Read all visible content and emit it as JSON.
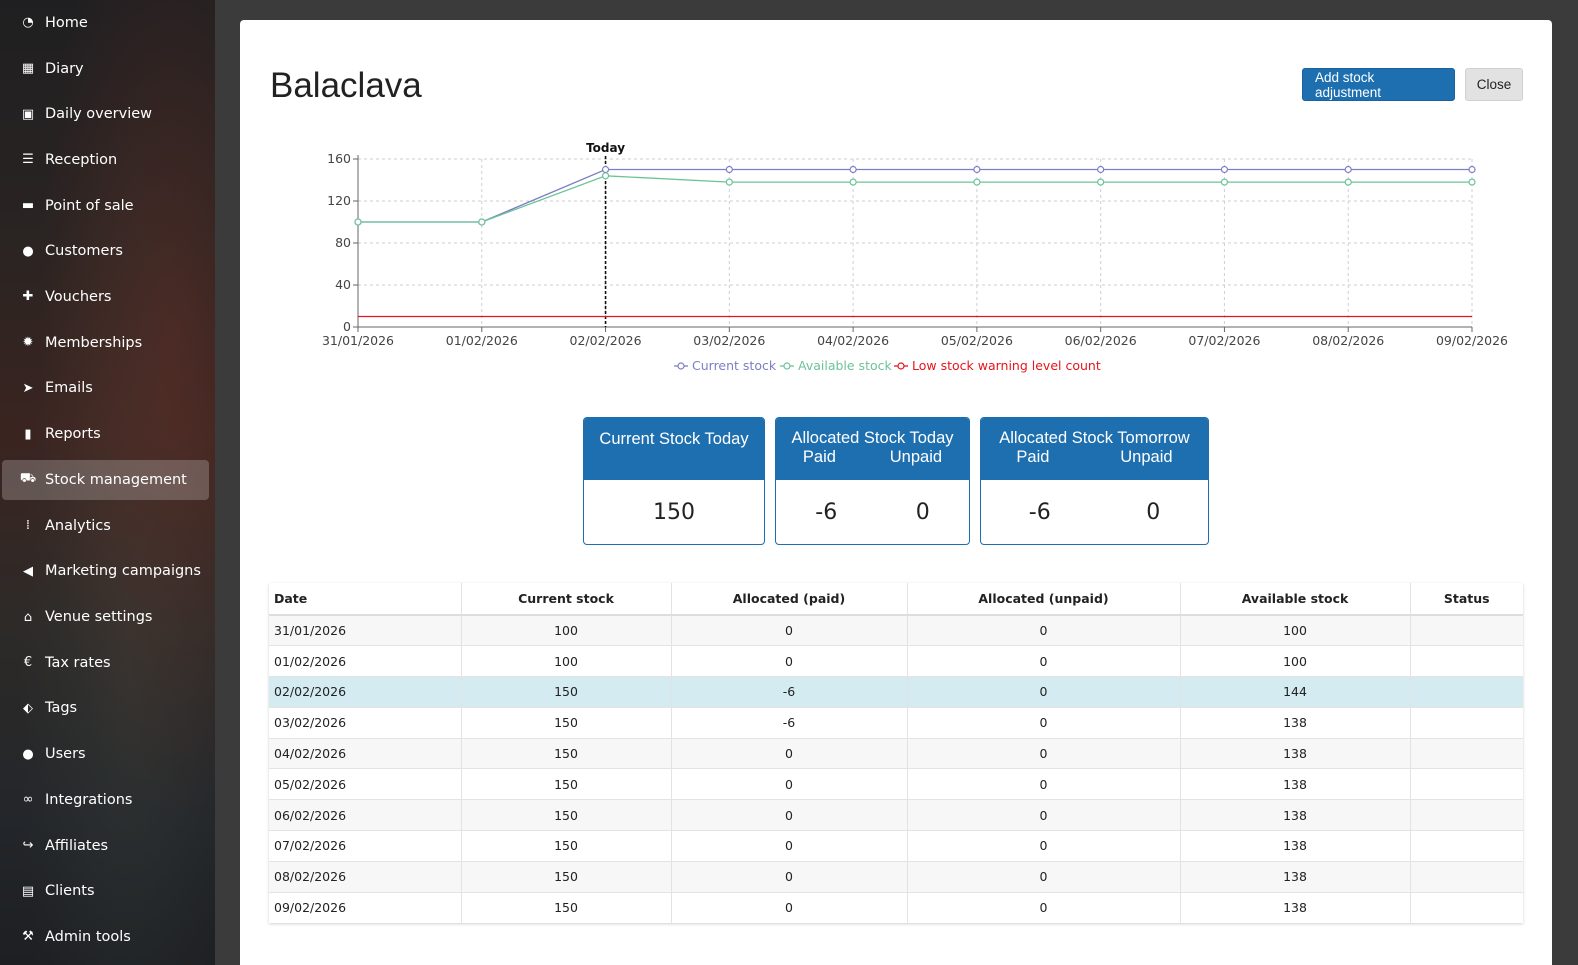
{
  "sidebar": {
    "items": [
      {
        "label": "Home",
        "icon": "dashboard-icon"
      },
      {
        "label": "Diary",
        "icon": "calendar-icon"
      },
      {
        "label": "Daily overview",
        "icon": "overview-icon"
      },
      {
        "label": "Reception",
        "icon": "reception-icon"
      },
      {
        "label": "Point of sale",
        "icon": "credit-card-icon"
      },
      {
        "label": "Customers",
        "icon": "user-icon"
      },
      {
        "label": "Vouchers",
        "icon": "gift-icon"
      },
      {
        "label": "Memberships",
        "icon": "badge-icon"
      },
      {
        "label": "Emails",
        "icon": "send-icon"
      },
      {
        "label": "Reports",
        "icon": "bar-chart-icon"
      },
      {
        "label": "Stock management",
        "icon": "cart-icon",
        "active": true
      },
      {
        "label": "Analytics",
        "icon": "analytics-icon"
      },
      {
        "label": "Marketing campaigns",
        "icon": "megaphone-icon"
      },
      {
        "label": "Venue settings",
        "icon": "home-icon"
      },
      {
        "label": "Tax rates",
        "icon": "euro-icon"
      },
      {
        "label": "Tags",
        "icon": "tags-icon"
      },
      {
        "label": "Users",
        "icon": "user-icon"
      },
      {
        "label": "Integrations",
        "icon": "link-icon"
      },
      {
        "label": "Affiliates",
        "icon": "share-icon"
      },
      {
        "label": "Clients",
        "icon": "briefcase-icon"
      },
      {
        "label": "Admin tools",
        "icon": "wrench-icon"
      }
    ]
  },
  "modal": {
    "title": "Balaclava",
    "add_adjustment_label": "Add stock adjustment",
    "close_label": "Close"
  },
  "chart_data": {
    "type": "line",
    "x": [
      "31/01/2026",
      "01/02/2026",
      "02/02/2026",
      "03/02/2026",
      "04/02/2026",
      "05/02/2026",
      "06/02/2026",
      "07/02/2026",
      "08/02/2026",
      "09/02/2026"
    ],
    "series": [
      {
        "name": "Current stock",
        "color": "#7b7fc4",
        "values": [
          100,
          100,
          150,
          150,
          150,
          150,
          150,
          150,
          150,
          150
        ]
      },
      {
        "name": "Available stock",
        "color": "#6cc398",
        "values": [
          100,
          100,
          144,
          138,
          138,
          138,
          138,
          138,
          138,
          138
        ]
      },
      {
        "name": "Low stock warning level count",
        "color": "#e8141b",
        "values": [
          10,
          10,
          10,
          10,
          10,
          10,
          10,
          10,
          10,
          10
        ]
      }
    ],
    "yticks": [
      0,
      40,
      80,
      120,
      160
    ],
    "ylim": [
      0,
      160
    ],
    "today_label": "Today",
    "today_index": 2,
    "grid": true,
    "legend": "bottom"
  },
  "cards": {
    "current": {
      "title": "Current Stock Today",
      "value": "150"
    },
    "today": {
      "title": "Allocated Stock Today",
      "paid_label": "Paid",
      "unpaid_label": "Unpaid",
      "paid": "-6",
      "unpaid": "0"
    },
    "tomorrow": {
      "title": "Allocated Stock Tomorrow",
      "paid_label": "Paid",
      "unpaid_label": "Unpaid",
      "paid": "-6",
      "unpaid": "0"
    }
  },
  "table": {
    "headers": [
      "Date",
      "Current stock",
      "Allocated (paid)",
      "Allocated (unpaid)",
      "Available stock",
      "Status"
    ],
    "rows": [
      [
        "31/01/2026",
        "100",
        "0",
        "0",
        "100",
        ""
      ],
      [
        "01/02/2026",
        "100",
        "0",
        "0",
        "100",
        ""
      ],
      [
        "02/02/2026",
        "150",
        "-6",
        "0",
        "144",
        ""
      ],
      [
        "03/02/2026",
        "150",
        "-6",
        "0",
        "138",
        ""
      ],
      [
        "04/02/2026",
        "150",
        "0",
        "0",
        "138",
        ""
      ],
      [
        "05/02/2026",
        "150",
        "0",
        "0",
        "138",
        ""
      ],
      [
        "06/02/2026",
        "150",
        "0",
        "0",
        "138",
        ""
      ],
      [
        "07/02/2026",
        "150",
        "0",
        "0",
        "138",
        ""
      ],
      [
        "08/02/2026",
        "150",
        "0",
        "0",
        "138",
        ""
      ],
      [
        "09/02/2026",
        "150",
        "0",
        "0",
        "138",
        ""
      ]
    ],
    "highlight_row": 2
  }
}
